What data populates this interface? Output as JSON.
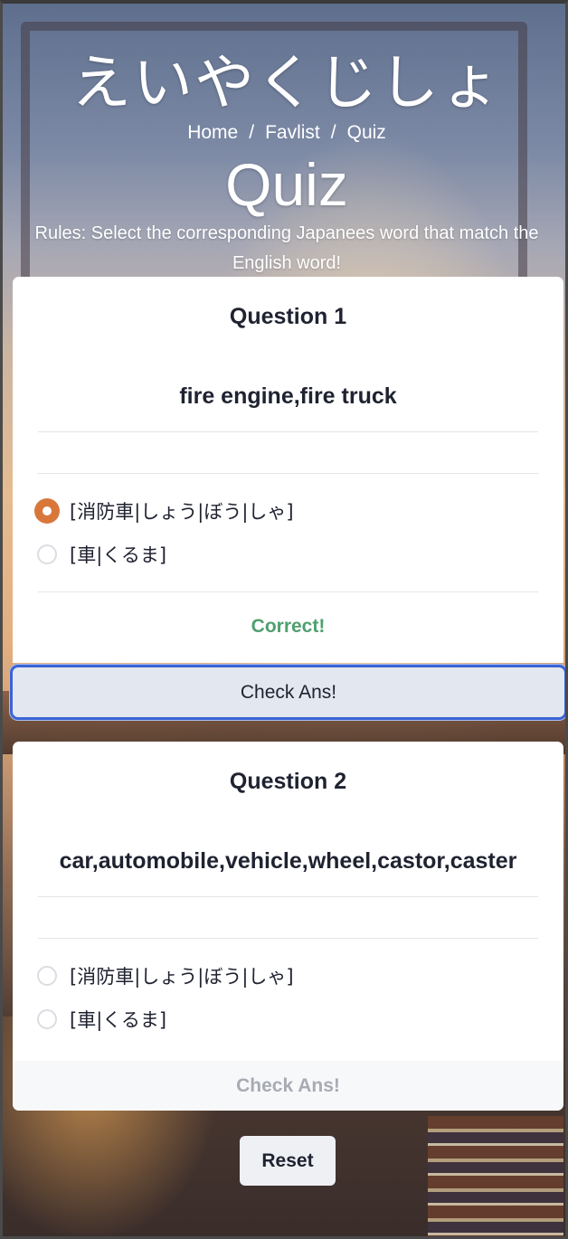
{
  "header": {
    "site_title": "えいやくじしょ",
    "breadcrumb": [
      {
        "label": "Home"
      },
      {
        "label": "Favlist"
      },
      {
        "label": "Quiz"
      }
    ],
    "separator": "/",
    "page_title": "Quiz",
    "rules": "Rules: Select the corresponding Japanees word that match the English word!"
  },
  "questions": [
    {
      "heading": "Question 1",
      "english": "fire engine,fire truck",
      "options": [
        "[消防車|しょう|ぼう|しゃ]",
        "[車|くるま]"
      ],
      "selected_index": 0,
      "result": "Correct!",
      "check_label": "Check Ans!"
    },
    {
      "heading": "Question 2",
      "english": "car,automobile,vehicle,wheel,castor,caster",
      "options": [
        "[消防車|しょう|ぼう|しゃ]",
        "[車|くるま]"
      ],
      "selected_index": null,
      "result": "",
      "check_label": "Check Ans!"
    }
  ],
  "reset_label": "Reset",
  "colors": {
    "accent_radio": "#d9773b",
    "correct_text": "#4fa070",
    "focus_ring": "#3c64d4"
  }
}
